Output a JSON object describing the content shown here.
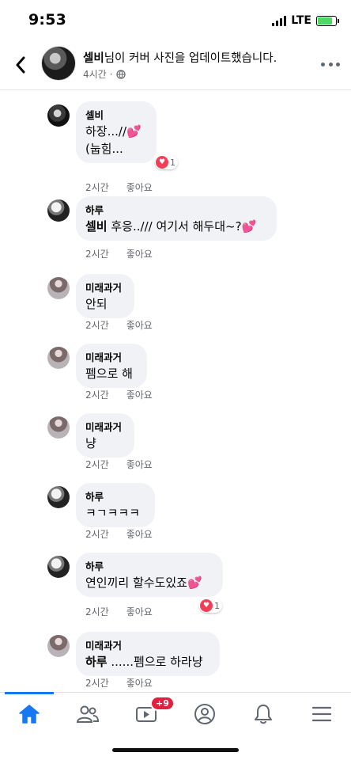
{
  "status_bar": {
    "time": "9:53",
    "network": "LTE"
  },
  "header": {
    "author_name": "셀비",
    "title_rest": "님이 커버 사진을 업데이트했습니다.",
    "time": "4시간",
    "privacy_icon": "globe-icon"
  },
  "comments": [
    {
      "author": "셀비",
      "text": "하장...//",
      "text2": "(눕힘...",
      "heart": true,
      "time": "2시간",
      "like": "좋아요",
      "reaction_count": "1"
    },
    {
      "author": "하루",
      "mention": "셀비",
      "text": " 후응../// 여기서 해두대~?",
      "heart": true,
      "time": "2시간",
      "like": "좋아요"
    },
    {
      "author": "미래과거",
      "text": "안되",
      "time": "2시간",
      "like": "좋아요"
    },
    {
      "author": "미래과거",
      "text": "펨으로 해",
      "time": "2시간",
      "like": "좋아요"
    },
    {
      "author": "미래과거",
      "text": "냥",
      "time": "2시간",
      "like": "좋아요"
    },
    {
      "author": "하루",
      "text": "ㅋㄱㅋㅋㅋ",
      "time": "2시간",
      "like": "좋아요"
    },
    {
      "author": "하루",
      "text": "연인끼리 할수도있죠",
      "heart": true,
      "time": "2시간",
      "like": "좋아요",
      "reaction_count": "1"
    },
    {
      "author": "미래과거",
      "mention": "하루",
      "text": " ......펨으로 하라냥",
      "time": "2시간",
      "like": "좋아요"
    }
  ],
  "bottom_nav": {
    "items": [
      "home-icon",
      "friends-icon",
      "watch-icon",
      "profile-icon",
      "bell-icon",
      "menu-icon"
    ],
    "watch_badge": "+9"
  },
  "colors": {
    "accent": "#1877f2",
    "badge": "#e41e3f",
    "heart": "#f0307a"
  }
}
